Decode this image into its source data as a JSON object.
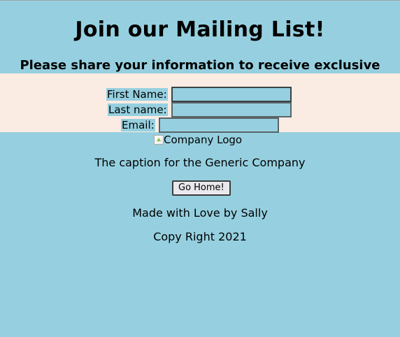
{
  "page": {
    "heading": "Join our Mailing List!",
    "subheading": "Please share your information to receive exclusive offers"
  },
  "form": {
    "first_name_label": "First Name:",
    "first_name_value": "",
    "last_name_label": "Last name:",
    "last_name_value": "",
    "email_label": "Email:",
    "email_value": ""
  },
  "logo": {
    "alt_text": "Company Logo",
    "icon": "broken-image-icon"
  },
  "caption": "The caption for the Generic Company",
  "home_button_label": "Go Home!",
  "footer": {
    "made_with": "Made with Love by Sally",
    "copyright": "Copy Right 2021"
  },
  "colors": {
    "background": "#96d0e0",
    "form_band": "#fbece3"
  }
}
